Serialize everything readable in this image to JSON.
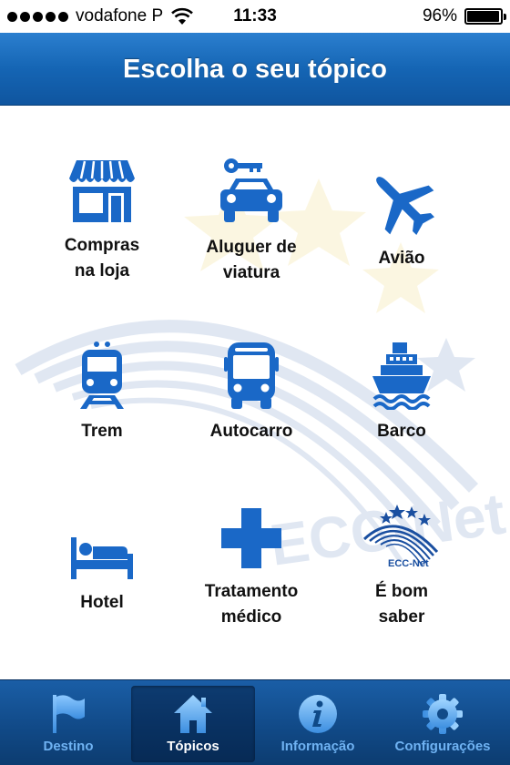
{
  "status_bar": {
    "carrier": "vodafone P",
    "time": "11:33",
    "battery_percent": "96%",
    "battery_level": 0.96,
    "signal_dots": 5
  },
  "header": {
    "title": "Escolha o seu tópico"
  },
  "topics": [
    {
      "id": "compras",
      "label_lines": [
        "Compras",
        "na loja"
      ],
      "icon": "shop-icon"
    },
    {
      "id": "aluguer",
      "label_lines": [
        "Aluguer de",
        "viatura"
      ],
      "icon": "car-rental-icon"
    },
    {
      "id": "aviao",
      "label_lines": [
        "Avião"
      ],
      "icon": "airplane-icon"
    },
    {
      "id": "trem",
      "label_lines": [
        "Trem"
      ],
      "icon": "train-icon"
    },
    {
      "id": "autocarro",
      "label_lines": [
        "Autocarro"
      ],
      "icon": "bus-icon"
    },
    {
      "id": "barco",
      "label_lines": [
        "Barco"
      ],
      "icon": "ship-icon"
    },
    {
      "id": "hotel",
      "label_lines": [
        "Hotel"
      ],
      "icon": "bed-icon"
    },
    {
      "id": "tratamento",
      "label_lines": [
        "Tratamento",
        "médico"
      ],
      "icon": "medical-cross-icon"
    },
    {
      "id": "bom-saber",
      "label_lines": [
        "É bom",
        "saber"
      ],
      "icon": "ecc-net-logo-icon"
    }
  ],
  "ecc_logo_text": "ECC-Net",
  "watermark_text": "ECC-Net",
  "tabs": [
    {
      "id": "destino",
      "label": "Destino",
      "icon": "flag-icon",
      "active": false
    },
    {
      "id": "topicos",
      "label": "Tópicos",
      "icon": "home-icon",
      "active": true
    },
    {
      "id": "informacao",
      "label": "Informação",
      "icon": "info-icon",
      "active": false
    },
    {
      "id": "configuracoes",
      "label": "Configurações",
      "icon": "gear-icon",
      "active": false
    }
  ],
  "colors": {
    "icon_blue": "#1a68c7",
    "header_blue": "#1565b4",
    "tab_label_inactive": "#6fb2f2",
    "tab_label_active": "#ffffff"
  }
}
